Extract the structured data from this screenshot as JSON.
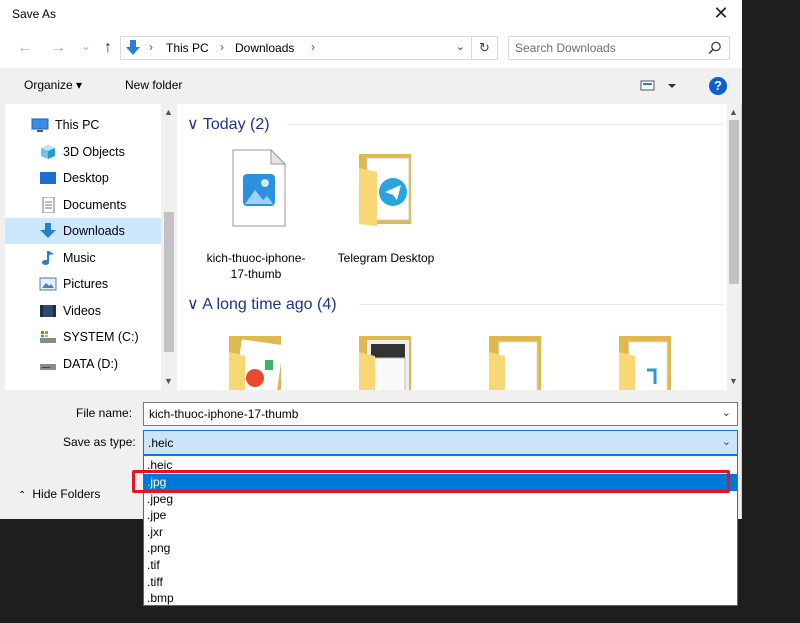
{
  "window": {
    "title": "Save As",
    "close_glyph": "✕"
  },
  "nav": {
    "back_glyph": "←",
    "forward_glyph": "→",
    "recent_glyph": "⌄",
    "up_glyph": "↑",
    "breadcrumbs": [
      "This PC",
      "Downloads"
    ],
    "crumb_separator": "›",
    "refresh_glyph": "↻",
    "dropdown_glyph": "⌄"
  },
  "search": {
    "placeholder": "Search Downloads"
  },
  "toolbar": {
    "organize": "Organize ▾",
    "new_folder": "New folder",
    "help": "?"
  },
  "sidebar": {
    "items": [
      {
        "label": "This PC",
        "icon": "pc-icon"
      },
      {
        "label": "3D Objects",
        "icon": "cube-icon"
      },
      {
        "label": "Desktop",
        "icon": "desktop-icon"
      },
      {
        "label": "Documents",
        "icon": "document-icon"
      },
      {
        "label": "Downloads",
        "icon": "download-icon",
        "selected": true
      },
      {
        "label": "Music",
        "icon": "music-icon"
      },
      {
        "label": "Pictures",
        "icon": "pictures-icon"
      },
      {
        "label": "Videos",
        "icon": "video-icon"
      },
      {
        "label": "SYSTEM (C:)",
        "icon": "system-drive-icon"
      },
      {
        "label": "DATA (D:)",
        "icon": "drive-icon"
      }
    ]
  },
  "groups": [
    {
      "label": "Today (2)",
      "chevron": "∨"
    },
    {
      "label": "A long time ago (4)",
      "chevron": "∨"
    }
  ],
  "files": {
    "today": [
      {
        "name": "kich-thuoc-iphone-17-thumb",
        "icon": "image-file-icon"
      },
      {
        "name": "Telegram Desktop",
        "icon": "telegram-folder-icon"
      }
    ]
  },
  "form": {
    "file_name_label": "File name:",
    "file_name_value": "kich-thuoc-iphone-17-thumb",
    "save_type_label": "Save as type:",
    "save_type_value": ".heic",
    "dropdown_glyph": "⌄"
  },
  "hide_folders": {
    "label": "Hide Folders",
    "chevron": "⌃"
  },
  "type_options": [
    ".heic",
    ".jpg",
    ".jpeg",
    ".jpe",
    ".jxr",
    ".png",
    ".tif",
    ".tiff",
    ".bmp"
  ],
  "selected_option_index": 1,
  "colors": {
    "accent": "#0078d7",
    "highlight_box": "#e8141f",
    "group_header": "#1e3287",
    "folder": "#f8d775"
  }
}
